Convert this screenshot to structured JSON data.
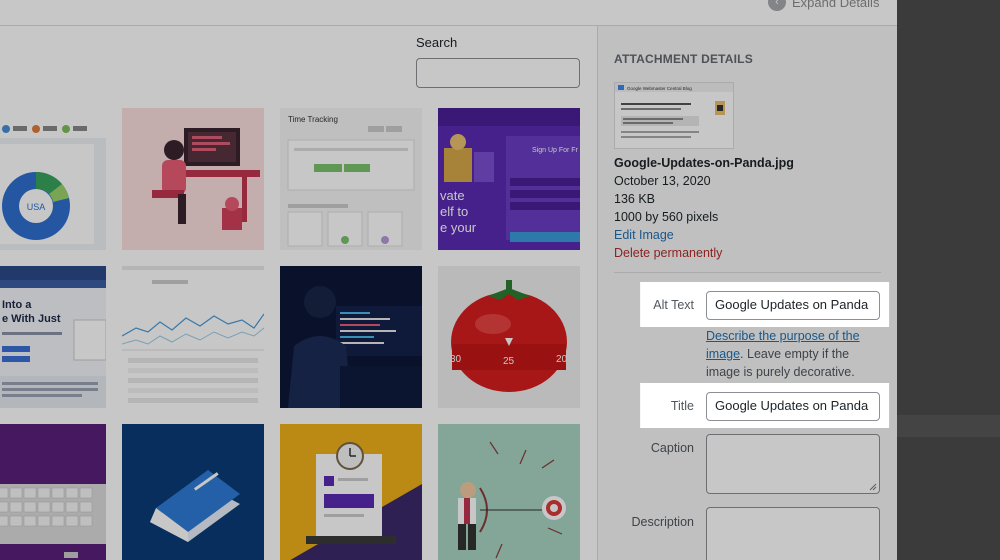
{
  "header": {
    "expand_label": "Expand Details",
    "expand_icon": "chevron-left-icon"
  },
  "search": {
    "label": "Search",
    "value": "",
    "placeholder": ""
  },
  "tiles": [
    {
      "name": "tile-donut-chart",
      "center_text": "USA"
    },
    {
      "name": "tile-developer-illustration"
    },
    {
      "name": "tile-time-tracking",
      "title": "Time Tracking"
    },
    {
      "name": "tile-purple-signup",
      "headline": "vate elf to e your",
      "button": "Sign Up For Fr"
    },
    {
      "name": "tile-webpage-screenshot",
      "headline": "Into a e With Just"
    },
    {
      "name": "tile-analytics-chart"
    },
    {
      "name": "tile-coding-dark"
    },
    {
      "name": "tile-tomato-timer",
      "timer_labels": [
        "30",
        "25",
        "20"
      ]
    },
    {
      "name": "tile-keyboard"
    },
    {
      "name": "tile-blue-book"
    },
    {
      "name": "tile-document-clock"
    },
    {
      "name": "tile-archery-target"
    }
  ],
  "sidebar": {
    "heading": "ATTACHMENT DETAILS",
    "file_name": "Google-Updates-on-Panda.jpg",
    "date": "October 13, 2020",
    "size": "136 KB",
    "dimensions": "1000 by 560 pixels",
    "edit_link": "Edit Image",
    "delete_link": "Delete permanently",
    "thumb_title": "Google Webmaster Central Blog",
    "alt_text": {
      "label": "Alt Text",
      "value": "Google Updates on Panda"
    },
    "alt_help_link": "Describe the purpose of the image",
    "alt_help_rest": ". Leave empty if the image is purely decorative.",
    "title": {
      "label": "Title",
      "value": "Google Updates on Panda"
    },
    "caption": {
      "label": "Caption",
      "value": ""
    },
    "description": {
      "label": "Description",
      "value": ""
    }
  },
  "colors": {
    "link": "#2271b1",
    "delete": "#b32d2e",
    "sidebar_bg": "#f6f7f7"
  }
}
